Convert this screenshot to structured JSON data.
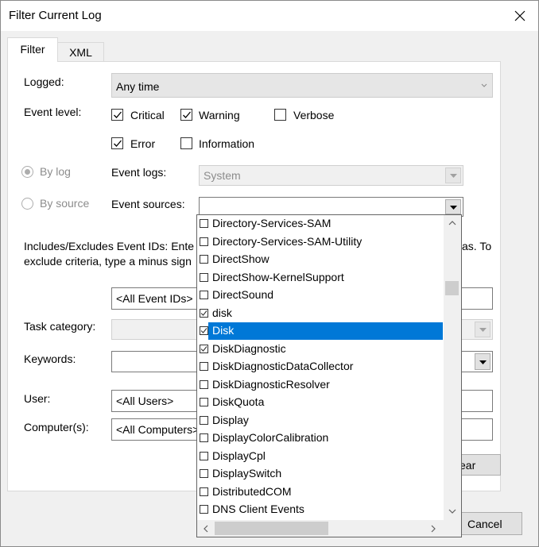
{
  "window": {
    "title": "Filter Current Log"
  },
  "tabs": [
    {
      "label": "Filter"
    },
    {
      "label": "XML"
    }
  ],
  "filter": {
    "logged_label": "Logged:",
    "logged_value": "Any time",
    "event_level_label": "Event level:",
    "levels": [
      {
        "label": "Critical",
        "checked": true
      },
      {
        "label": "Warning",
        "checked": true
      },
      {
        "label": "Verbose",
        "checked": false
      },
      {
        "label": "Error",
        "checked": true
      },
      {
        "label": "Information",
        "checked": false
      }
    ],
    "by_log_label": "By log",
    "by_source_label": "By source",
    "event_logs_label": "Event logs:",
    "event_logs_value": "System",
    "event_sources_label": "Event sources:",
    "event_sources_value": "",
    "includes_text_1": "Includes/Excludes Event IDs: Ente",
    "includes_text_1b": "as. To",
    "includes_text_2": "exclude criteria, type a minus sign",
    "event_ids_value": "<All Event IDs>",
    "task_category_label": "Task category:",
    "keywords_label": "Keywords:",
    "user_label": "User:",
    "user_value": "<All Users>",
    "computer_label": "Computer(s):",
    "computer_value": "<All Computers>",
    "clear_label": "ear"
  },
  "footer": {
    "cancel_label": "Cancel"
  },
  "sources_list": [
    {
      "label": "Directory-Services-SAM",
      "checked": false
    },
    {
      "label": "Directory-Services-SAM-Utility",
      "checked": false
    },
    {
      "label": "DirectShow",
      "checked": false
    },
    {
      "label": "DirectShow-KernelSupport",
      "checked": false
    },
    {
      "label": "DirectSound",
      "checked": false
    },
    {
      "label": "disk",
      "checked": true
    },
    {
      "label": "Disk",
      "checked": true,
      "selected": true
    },
    {
      "label": "DiskDiagnostic",
      "checked": true
    },
    {
      "label": "DiskDiagnosticDataCollector",
      "checked": false
    },
    {
      "label": "DiskDiagnosticResolver",
      "checked": false
    },
    {
      "label": "DiskQuota",
      "checked": false
    },
    {
      "label": "Display",
      "checked": false
    },
    {
      "label": "DisplayColorCalibration",
      "checked": false
    },
    {
      "label": "DisplayCpl",
      "checked": false
    },
    {
      "label": "DisplaySwitch",
      "checked": false
    },
    {
      "label": "DistributedCOM",
      "checked": false
    },
    {
      "label": "DNS Client Events",
      "checked": false
    }
  ]
}
